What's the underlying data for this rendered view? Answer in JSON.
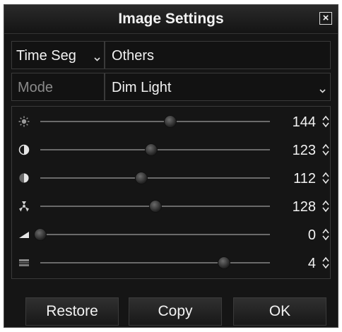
{
  "dialog": {
    "title": "Image Settings"
  },
  "time_seg": {
    "label": "Time Seg",
    "value": "Others"
  },
  "mode": {
    "label": "Mode",
    "value": "Dim Light"
  },
  "sliders": [
    {
      "name": "brightness",
      "icon": "brightness-icon",
      "value": "144",
      "level": 0.565
    },
    {
      "name": "contrast",
      "icon": "contrast-icon",
      "value": "123",
      "level": 0.482
    },
    {
      "name": "saturation",
      "icon": "saturation-icon",
      "value": "112",
      "level": 0.439
    },
    {
      "name": "hue",
      "icon": "hue-icon",
      "value": "128",
      "level": 0.502
    },
    {
      "name": "sharpness",
      "icon": "sharpness-icon",
      "value": "0",
      "level": 0.0
    },
    {
      "name": "denoise",
      "icon": "denoise-icon",
      "value": "4",
      "level": 0.8
    }
  ],
  "buttons": {
    "restore": "Restore",
    "copy": "Copy",
    "ok": "OK"
  },
  "colors": {
    "background": "#151515",
    "text": "#f2f2f2",
    "muted_text": "#8a8a8a",
    "track": "#6a6a6a"
  }
}
